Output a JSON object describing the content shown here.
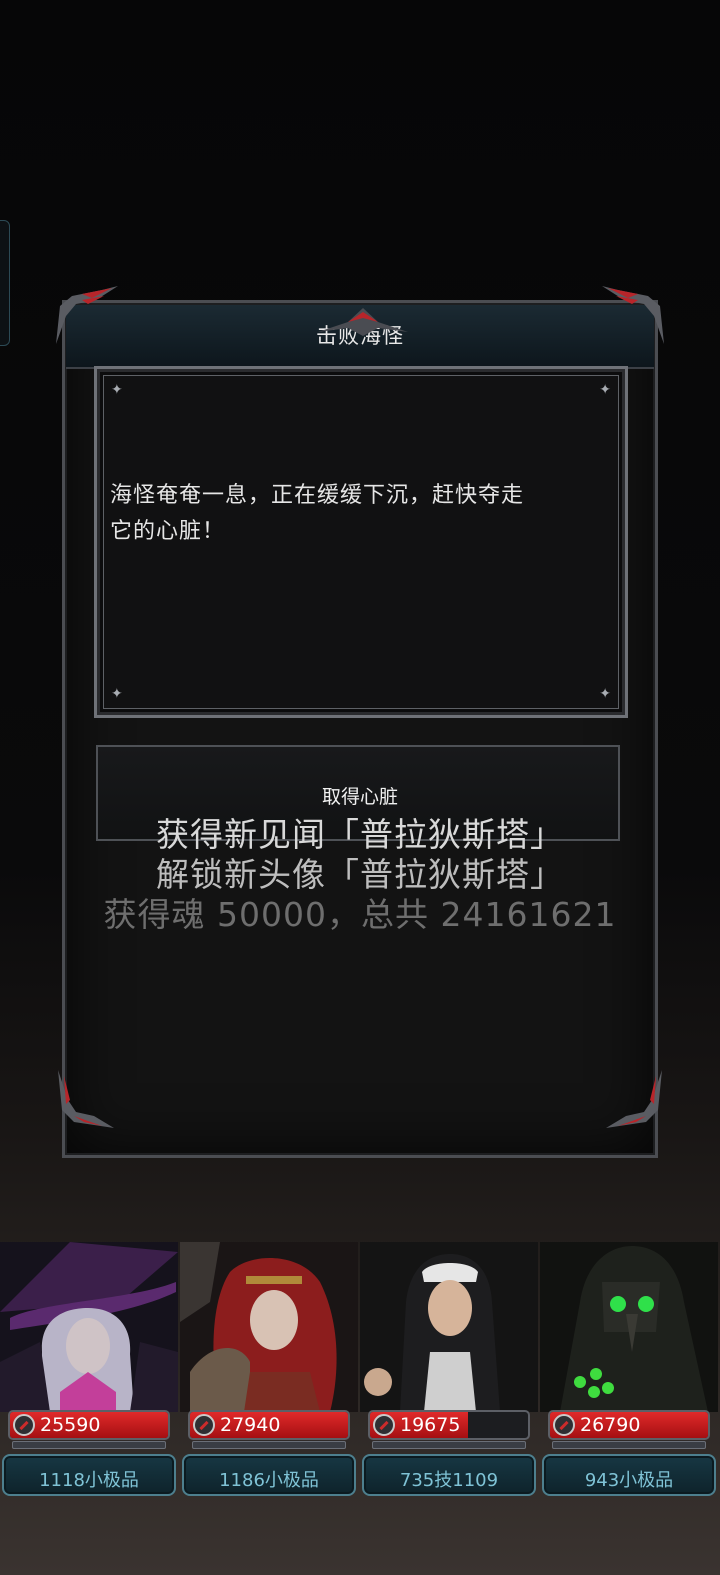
{
  "dialog": {
    "title": "击败海怪",
    "text_line1": "海怪奄奄一息，正在缓缓下沉，赶快夺走",
    "text_line2": "它的心脏！",
    "choice_label": "取得心脏"
  },
  "rewards": {
    "line1": "获得新见闻「普拉狄斯塔」",
    "line2": "解锁新头像「普拉狄斯塔」",
    "line3": "获得魂 50000，总共 24161621"
  },
  "party": [
    {
      "name": "witch",
      "hp": "25590",
      "hp_fill": 1.0,
      "tag": "1118小极品"
    },
    {
      "name": "red-haired-warrior",
      "hp": "27940",
      "hp_fill": 1.0,
      "tag": "1186小极品"
    },
    {
      "name": "nun",
      "hp": "19675",
      "hp_fill": 0.62,
      "tag": "735技1109"
    },
    {
      "name": "plague-doctor",
      "hp": "26790",
      "hp_fill": 1.0,
      "tag": "943小极品"
    }
  ],
  "colors": {
    "hp_red": "#d21f22",
    "tag_text": "#7fc3d6",
    "frame_red": "#b8252a"
  }
}
